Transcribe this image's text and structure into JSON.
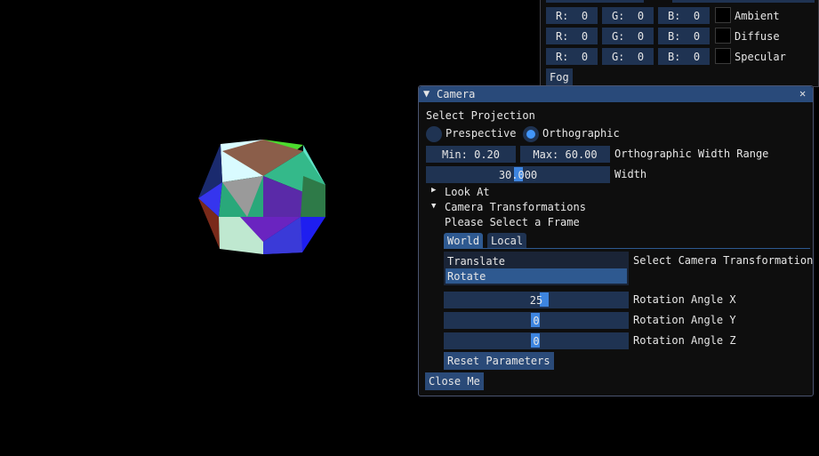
{
  "lighting": {
    "rows": [
      {
        "r": "R:  0",
        "g": "G:  0",
        "b": "B:  0",
        "label": "Ambient"
      },
      {
        "r": "R:  0",
        "g": "G:  0",
        "b": "B:  0",
        "label": "Diffuse"
      },
      {
        "r": "R:  0",
        "g": "G:  0",
        "b": "B:  0",
        "label": "Specular"
      }
    ],
    "fog_label": "Fog"
  },
  "camera": {
    "title": "Camera",
    "title_arrow": "▼",
    "close_glyph": "✕",
    "select_projection": "Select Projection",
    "projection_options": [
      "Prespective",
      "Orthographic"
    ],
    "projection_selected": "Orthographic",
    "ortho_min": "Min: 0.20",
    "ortho_max": "Max: 60.00",
    "ortho_range_label": "Orthographic Width Range",
    "width_value": "30.000",
    "width_label": "Width",
    "look_at": {
      "arrow": "▶",
      "label": "Look At"
    },
    "transformations": {
      "arrow": "▼",
      "label": "Camera Transformations"
    },
    "frame_prompt": "Please Select a Frame",
    "tabs": [
      "World",
      "Local"
    ],
    "active_tab": "World",
    "transform_options": [
      "Translate",
      "Rotate"
    ],
    "transform_selected": "Rotate",
    "transform_label": "Select Camera Transformation",
    "rotation": [
      {
        "value": "25",
        "label": "Rotation Angle X"
      },
      {
        "value": "0",
        "label": "Rotation Angle Y"
      },
      {
        "value": "0",
        "label": "Rotation Angle Z"
      }
    ],
    "reset_button": "Reset Parameters",
    "close_button": "Close Me"
  }
}
